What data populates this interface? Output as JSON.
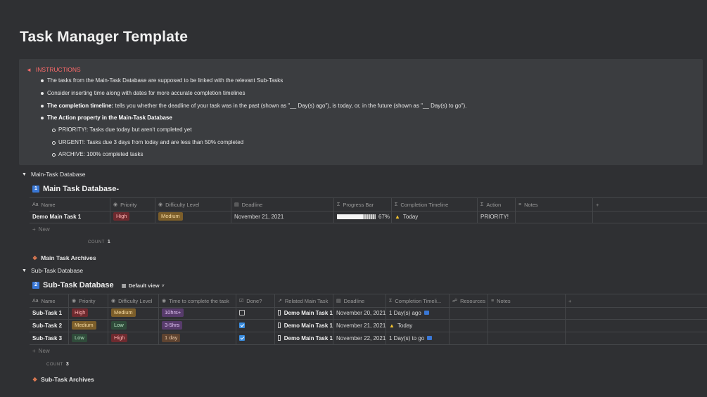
{
  "page": {
    "title": "Task Manager Template"
  },
  "instructions": {
    "header": "INSTRUCTIONS",
    "icon": "megaphone-icon",
    "bullets": [
      "The tasks from the Main-Task Database are supposed to be linked with the relevant Sub-Tasks",
      "Consider inserting time along with dates for more accurate completion timelines"
    ],
    "timeline_bold": "The completion timeline:",
    "timeline_text": " tells you whether the deadline of your task was in the past (shown as \"__ Day(s) ago\"), is today, or, in the future (shown as \"__ Day(s) to go\").",
    "action_bold": "The Action property in the Main-Task Database",
    "sub_bullets": [
      "PRIORITY!: Tasks due today but aren't completed yet",
      "URGENT!: Tasks due 3 days from today and are less than 50% completed",
      "ARCHIVE: 100% completed tasks"
    ]
  },
  "main_toggle": {
    "label": "Main-Task Database"
  },
  "main_db": {
    "number": "1",
    "title": "Main Task Database-",
    "headers": [
      "Name",
      "Priority",
      "Difficulty Level",
      "Deadline",
      "Progress Bar",
      "Completion Timeline",
      "Action",
      "Notes"
    ],
    "rows": [
      {
        "name": "Demo Main Task 1",
        "priority": "High",
        "difficulty": "Medium",
        "deadline": "November 21, 2021",
        "progress": 0.67,
        "progress_label": "67%",
        "timeline": "Today",
        "action": "PRIORITY!",
        "notes": ""
      }
    ],
    "new_label": "New",
    "count_label": "COUNT",
    "count_value": "1",
    "archive_label": "Main Task Archives"
  },
  "sub_toggle": {
    "label": "Sub-Task Database"
  },
  "sub_db": {
    "number": "2",
    "title": "Sub-Task Database",
    "view_label": "Default view",
    "headers": [
      "Name",
      "Priority",
      "Difficulty Level",
      "Time to complete the task",
      "Done?",
      "Related Main Task",
      "Deadline",
      "Completion Timeli...",
      "Resources",
      "Notes"
    ],
    "rows": [
      {
        "name": "Sub-Task 1",
        "priority": "High",
        "difficulty": "Medium",
        "time": "10hrs+",
        "done": false,
        "related": "Demo Main Task 1",
        "deadline": "November 20, 2021",
        "timeline": "1 Day(s) ago"
      },
      {
        "name": "Sub-Task 2",
        "priority": "Medium",
        "difficulty": "Low",
        "time": "3-5hrs",
        "done": true,
        "related": "Demo Main Task 1",
        "deadline": "November 21, 2021",
        "timeline": "Today"
      },
      {
        "name": "Sub-Task 3",
        "priority": "Low",
        "difficulty": "High",
        "time": "1 day",
        "done": true,
        "related": "Demo Main Task 1",
        "deadline": "November 22, 2021",
        "timeline": "1 Day(s) to go"
      }
    ],
    "new_label": "New",
    "count_label": "COUNT",
    "count_value": "3",
    "archive_label": "Sub-Task Archives"
  },
  "colors": {
    "background": "#2f3033",
    "callout": "#3b3d40",
    "accent_red": "#ff6b6b",
    "accent_blue": "#3a78d6"
  }
}
